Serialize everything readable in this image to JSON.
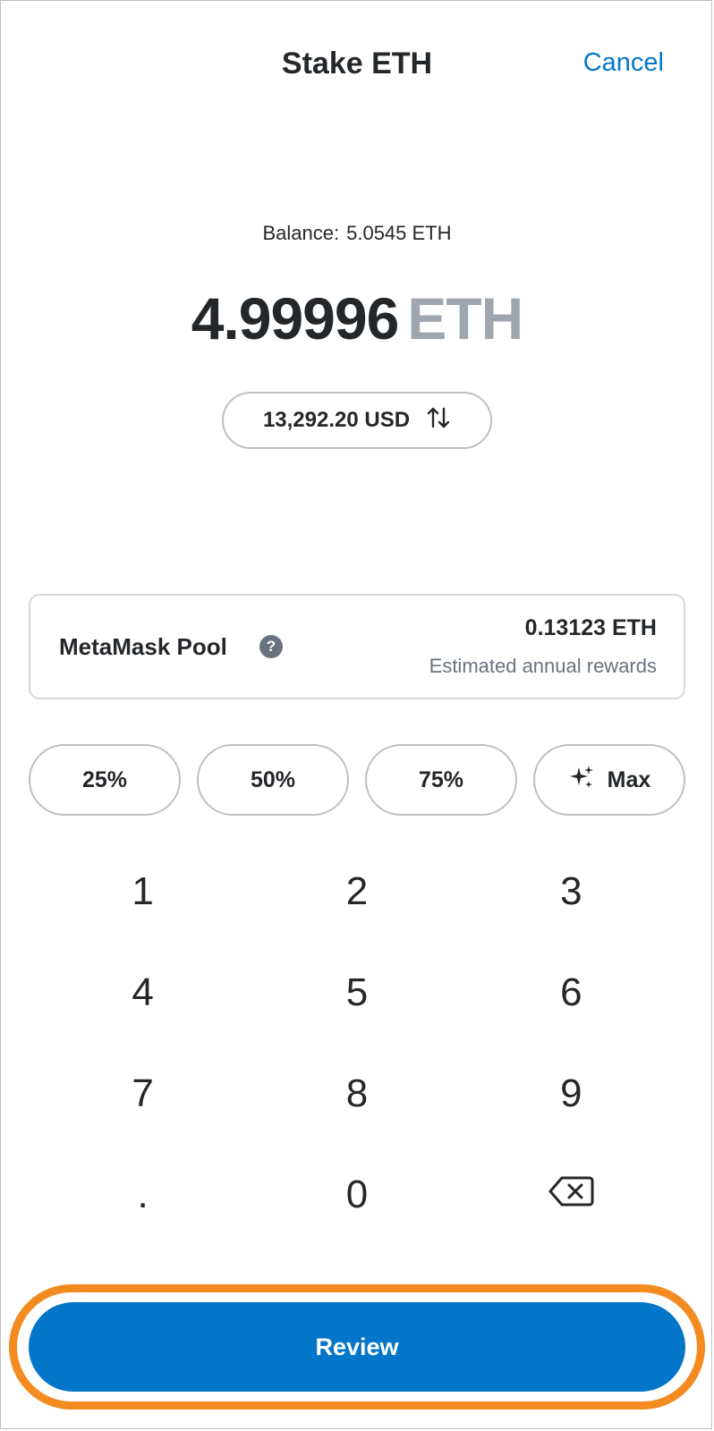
{
  "header": {
    "title": "Stake ETH",
    "cancel_label": "Cancel"
  },
  "balance": {
    "label": "Balance:",
    "value": "5.0545 ETH"
  },
  "amount": {
    "value": "4.99996",
    "unit": "ETH"
  },
  "fiat_toggle": {
    "label": "13,292.20 USD",
    "icon": "swap-arrows-icon"
  },
  "pool": {
    "name": "MetaMask Pool",
    "help_icon": "?",
    "rewards_value": "0.13123 ETH",
    "rewards_label": "Estimated annual rewards"
  },
  "percent_buttons": [
    "25%",
    "50%",
    "75%",
    "Max"
  ],
  "max_icon": "sparkle-icon",
  "keypad": [
    "1",
    "2",
    "3",
    "4",
    "5",
    "6",
    "7",
    "8",
    "9",
    ".",
    "0"
  ],
  "backspace_icon": "backspace-icon",
  "review_label": "Review",
  "colors": {
    "accent": "#0376c9",
    "highlight": "#f38b20",
    "muted": "#9fa6ae"
  }
}
